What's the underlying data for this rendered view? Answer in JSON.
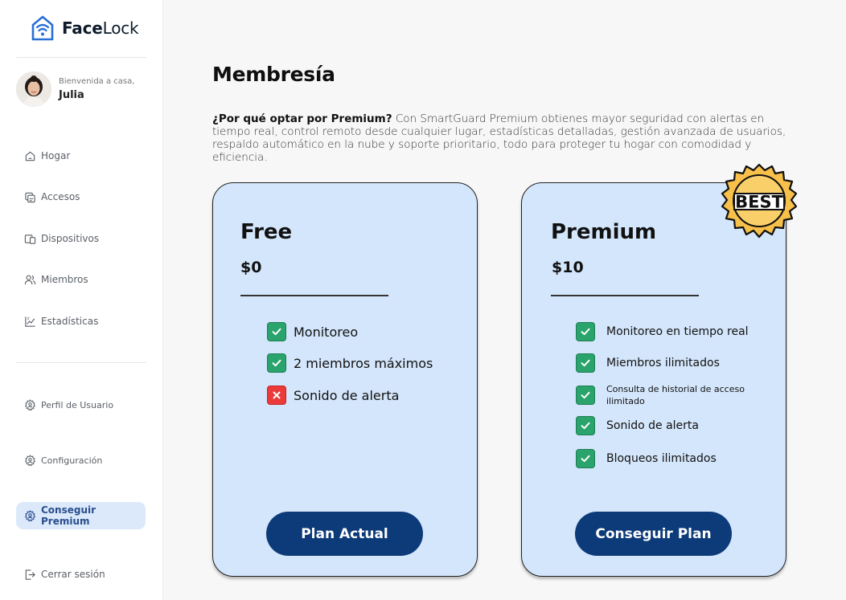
{
  "app": {
    "name_bold": "Face",
    "name_light": "Lock"
  },
  "user": {
    "greeting": "Bienvenida a casa,",
    "name": "Julia"
  },
  "nav": {
    "home": "Hogar",
    "access": "Accesos",
    "devices": "Dispositivos",
    "members": "Miembros",
    "stats": "Estadísticas",
    "profile": "Perfil de Usuario",
    "settings": "Configuración",
    "premium": "Conseguir Premium",
    "logout": "Cerrar sesión"
  },
  "page": {
    "title": "Membresía",
    "intro_bold": "¿Por qué optar por Premium?",
    "intro_text": " Con SmartGuard Premium obtienes mayor seguridad con alertas en tiempo real, control remoto desde cualquier lugar, estadísticas detalladas, gestión avanzada de usuarios, respaldo automático en la nube y soporte prioritario, todo para proteger tu hogar con comodidad y eficiencia."
  },
  "plans": {
    "free": {
      "name": "Free",
      "price": "$0",
      "features": [
        "Monitoreo",
        "2 miembros máximos",
        "Sonido de alerta"
      ],
      "included": [
        true,
        true,
        false
      ],
      "button": "Plan Actual"
    },
    "premium": {
      "name": "Premium",
      "price": "$10",
      "features": [
        "Monitoreo en tiempo real",
        "Miembros ilimitados",
        "Consulta de historial de acceso ilimitado",
        "Sonido de alerta",
        "Bloqueos ilimitados"
      ],
      "included": [
        true,
        true,
        true,
        true,
        true
      ],
      "button": "Conseguir Plan"
    }
  },
  "badge": {
    "text": "BEST"
  },
  "colors": {
    "accent": "#0d3a78",
    "card_bg": "#d4e6fb",
    "check_green": "#2aa36c",
    "cross_red": "#ea3a3a",
    "active_nav_bg": "#dbe9fb",
    "badge_gold": "#f7c04a"
  },
  "icons": {
    "logo": "house-wifi-icon",
    "home": "home-icon",
    "access": "access-icon",
    "devices": "devices-icon",
    "members": "users-icon",
    "stats": "chart-icon",
    "profile": "gear-icon",
    "settings": "gear-icon",
    "premium": "gear-icon",
    "logout": "logout-icon",
    "check": "check-icon",
    "cross": "cross-icon"
  }
}
